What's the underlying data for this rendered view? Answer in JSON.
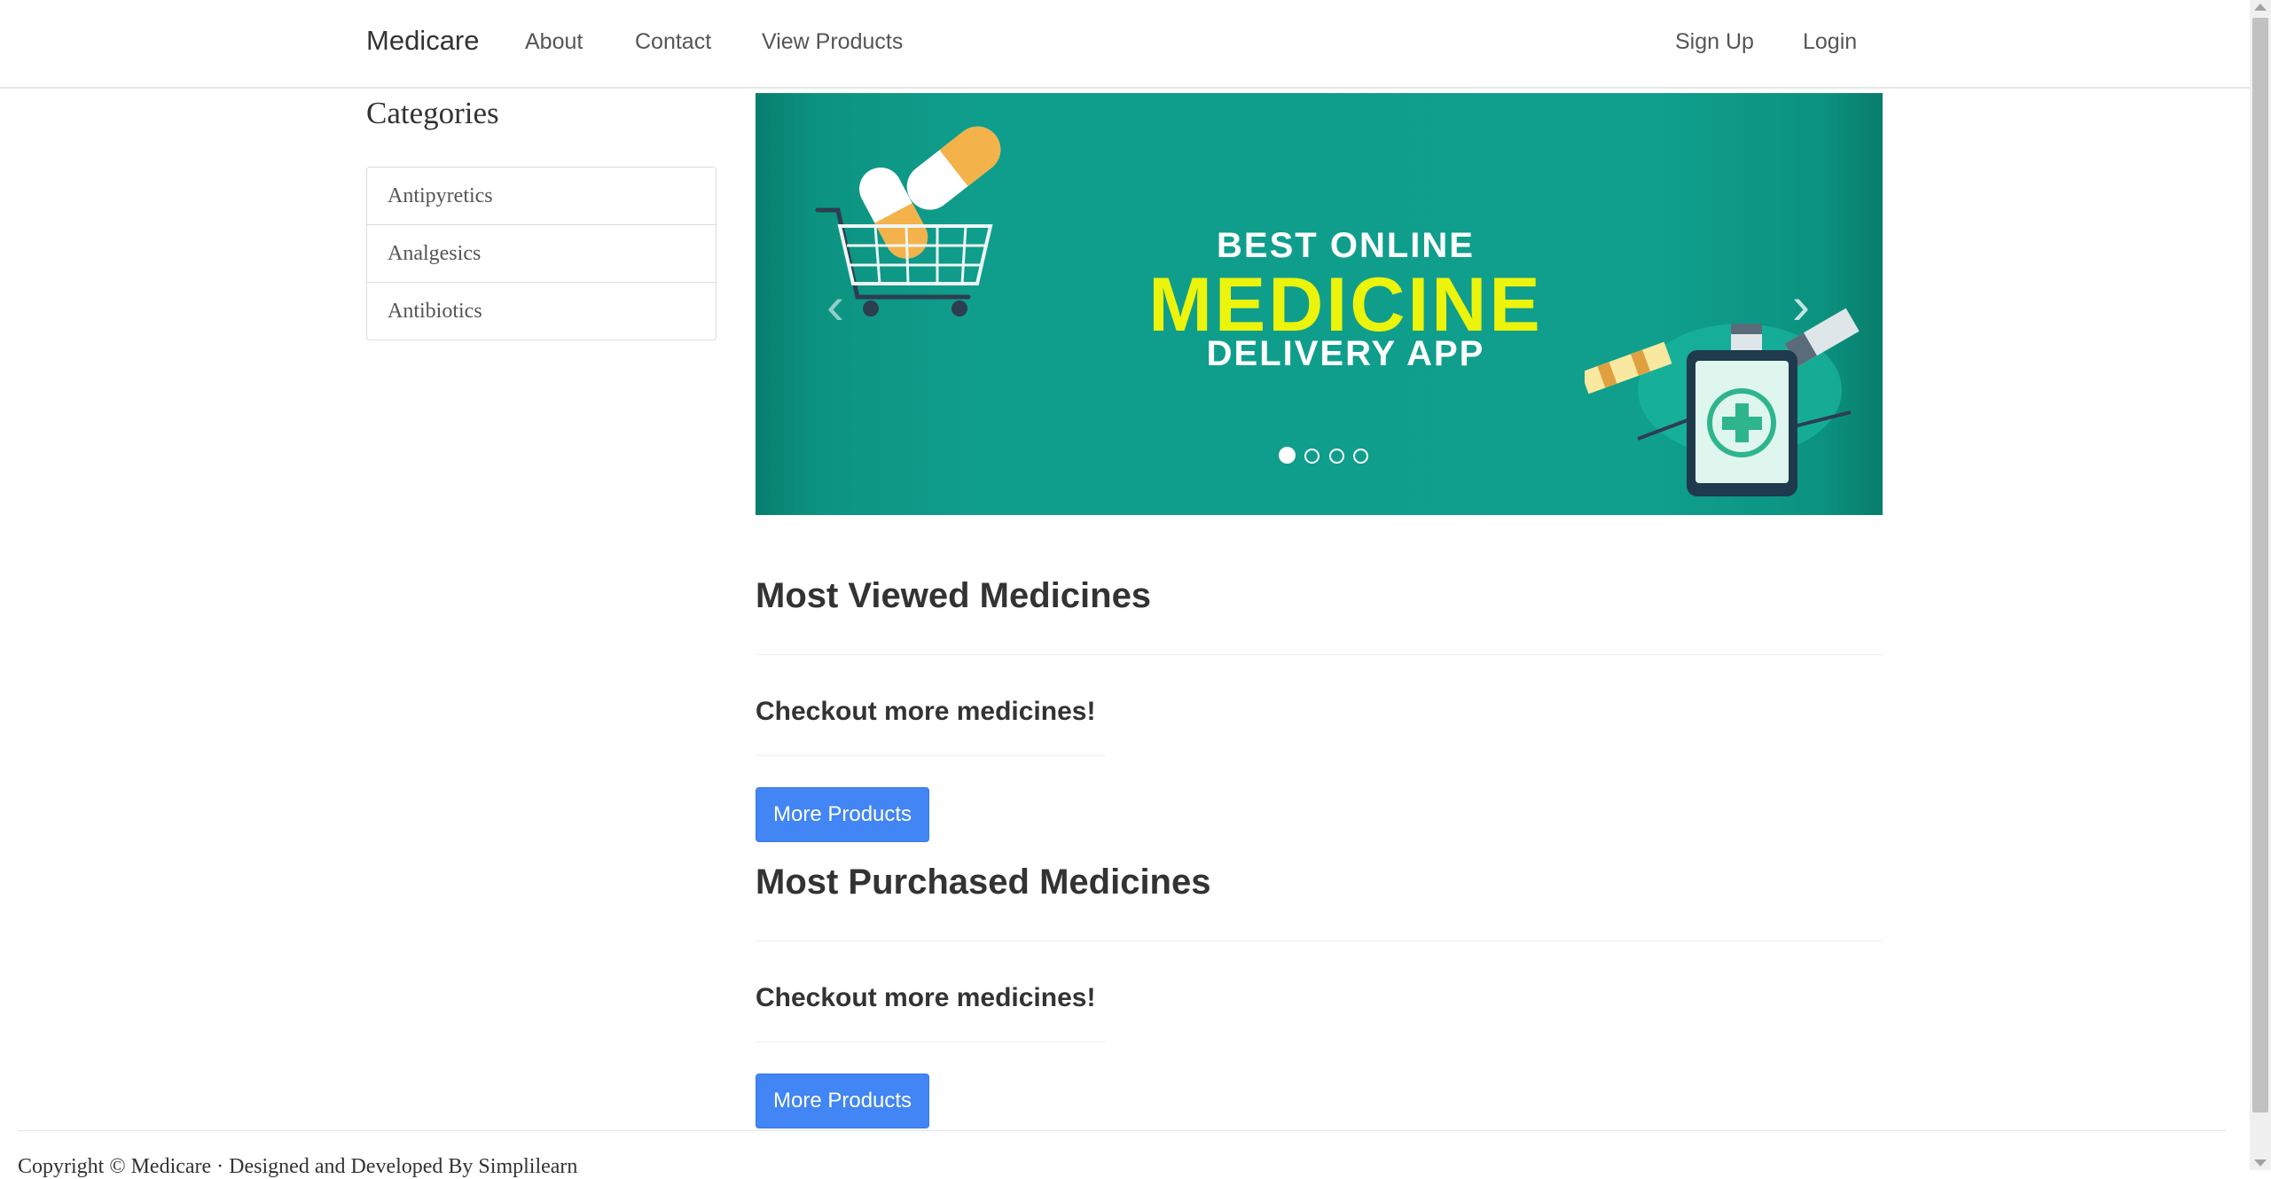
{
  "navbar": {
    "brand": "Medicare",
    "links": [
      "About",
      "Contact",
      "View Products"
    ],
    "right_links": [
      "Sign Up",
      "Login"
    ]
  },
  "sidebar": {
    "title": "Categories",
    "items": [
      "Antipyretics",
      "Analgesics",
      "Antibiotics"
    ]
  },
  "carousel": {
    "line1": "BEST ONLINE",
    "line2": "MEDICINE",
    "line3": "DELIVERY APP",
    "prev": "‹",
    "next": "›",
    "slide_count": 4,
    "active_slide": 1
  },
  "sections": [
    {
      "title": "Most Viewed Medicines",
      "subtitle": "Checkout more medicines!",
      "button": "More Products"
    },
    {
      "title": "Most Purchased Medicines",
      "subtitle": "Checkout more medicines!",
      "button": "More Products"
    }
  ],
  "footer": {
    "text": "Copyright © Medicare · Designed and Developed By Simplilearn"
  },
  "colors": {
    "accent": "#4285f4",
    "banner": "#109e8c",
    "banner_headline": "#ecf40b"
  }
}
